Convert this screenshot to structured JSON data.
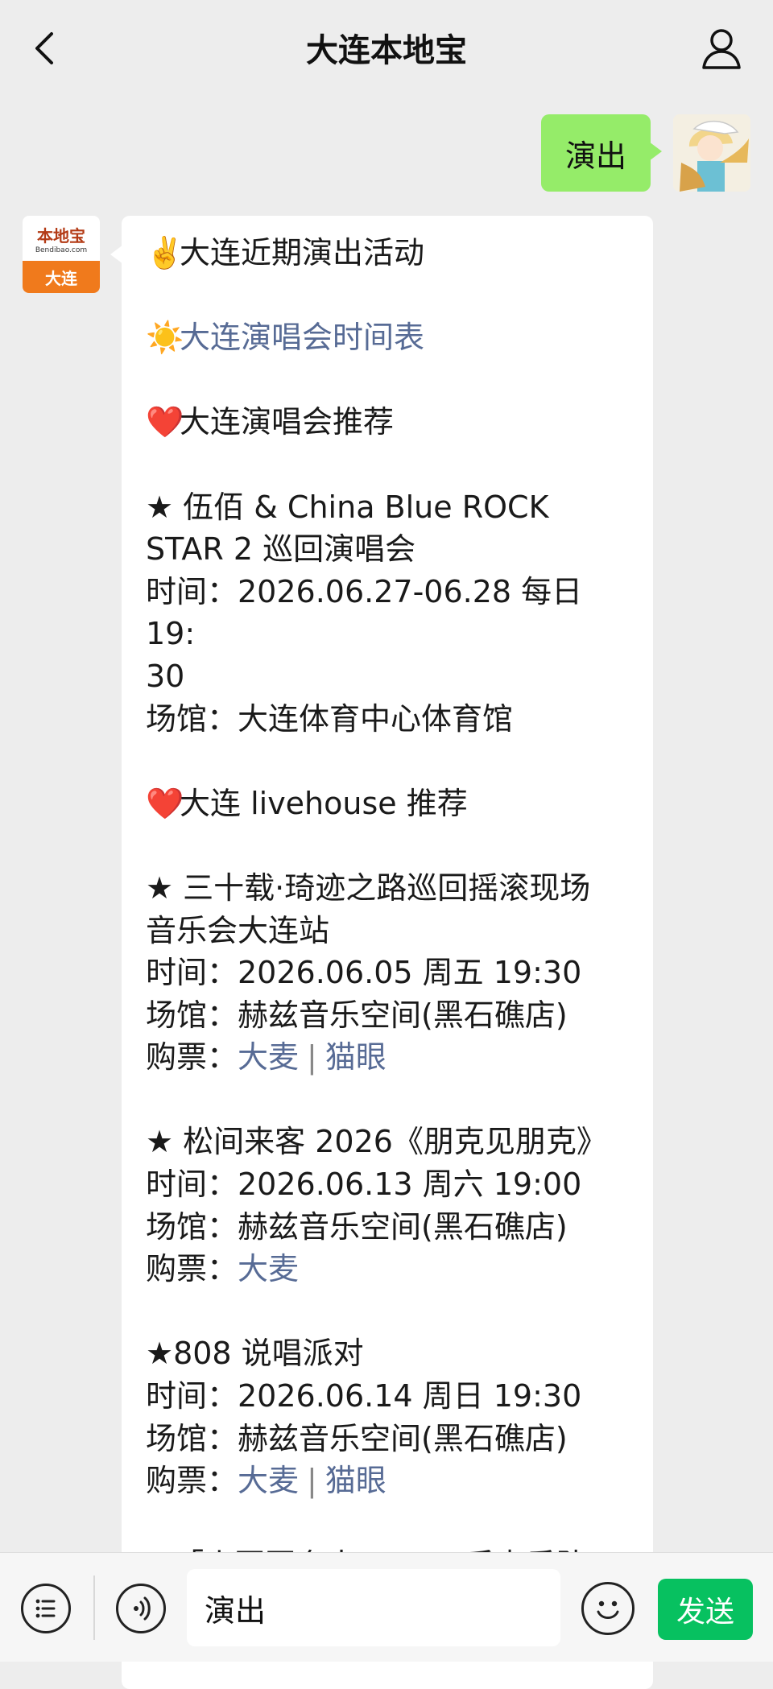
{
  "header": {
    "title": "大连本地宝",
    "back_icon": "chevron-left-icon",
    "user_icon": "person-icon"
  },
  "user_message": {
    "text": "演出"
  },
  "bot": {
    "avatar": {
      "brand": "本地宝",
      "domain": "Bendibao.com",
      "city": "大连"
    },
    "lines": [
      {
        "type": "text",
        "emoji": "✌️",
        "text": "大连近期演出活动"
      },
      {
        "type": "blank"
      },
      {
        "type": "link",
        "emoji": "☀️",
        "text": "大连演唱会时间表"
      },
      {
        "type": "blank"
      },
      {
        "type": "text",
        "emoji": "❤️",
        "text": "大连演唱会推荐"
      },
      {
        "type": "blank"
      },
      {
        "type": "text",
        "text": "★ 伍佰 & China Blue ROCK"
      },
      {
        "type": "text",
        "text": "STAR 2 巡回演唱会"
      },
      {
        "type": "text",
        "text": "时间：2026.06.27-06.28 每日 19:"
      },
      {
        "type": "text",
        "text": "30"
      },
      {
        "type": "text",
        "text": "场馆：大连体育中心体育馆"
      },
      {
        "type": "blank"
      },
      {
        "type": "text",
        "emoji": "❤️",
        "text": "大连 livehouse 推荐"
      },
      {
        "type": "blank"
      },
      {
        "type": "text",
        "text": "★ 三十载·琦迹之路巡回摇滚现场"
      },
      {
        "type": "text",
        "text": "音乐会大连站"
      },
      {
        "type": "text",
        "text": "时间：2026.06.05 周五 19:30"
      },
      {
        "type": "text",
        "text": "场馆：赫兹音乐空间(黑石礁店)"
      },
      {
        "type": "tickets",
        "label": "购票：",
        "links": [
          "大麦",
          "猫眼"
        ]
      },
      {
        "type": "blank"
      },
      {
        "type": "text",
        "text": "★ 松间来客 2026《朋克见朋克》"
      },
      {
        "type": "text",
        "text": "时间：2026.06.13 周六 19:00"
      },
      {
        "type": "text",
        "text": "场馆：赫兹音乐空间(黑石礁店)"
      },
      {
        "type": "tickets",
        "label": "购票：",
        "links": [
          "大麦"
        ]
      },
      {
        "type": "blank"
      },
      {
        "type": "text",
        "text": "★808 说唱派对"
      },
      {
        "type": "text",
        "text": "时间：2026.06.14 周日 19:30"
      },
      {
        "type": "text",
        "text": "场馆：赫兹音乐空间(黑石礁店)"
      },
      {
        "type": "tickets",
        "label": "购票：",
        "links": [
          "大麦",
          "猫眼"
        ]
      },
      {
        "type": "blank"
      },
      {
        "type": "text",
        "text": "★「小圈圈套出___？」后声乐队"
      }
    ]
  },
  "input_bar": {
    "value": "演出",
    "send_label": "发送",
    "menu_icon": "list-icon",
    "voice_icon": "voice-icon",
    "emoji_icon": "smiley-icon"
  },
  "colors": {
    "accent_green": "#07c160",
    "bubble_green": "#95ec69",
    "link_blue": "#576b95",
    "background": "#ededed"
  }
}
